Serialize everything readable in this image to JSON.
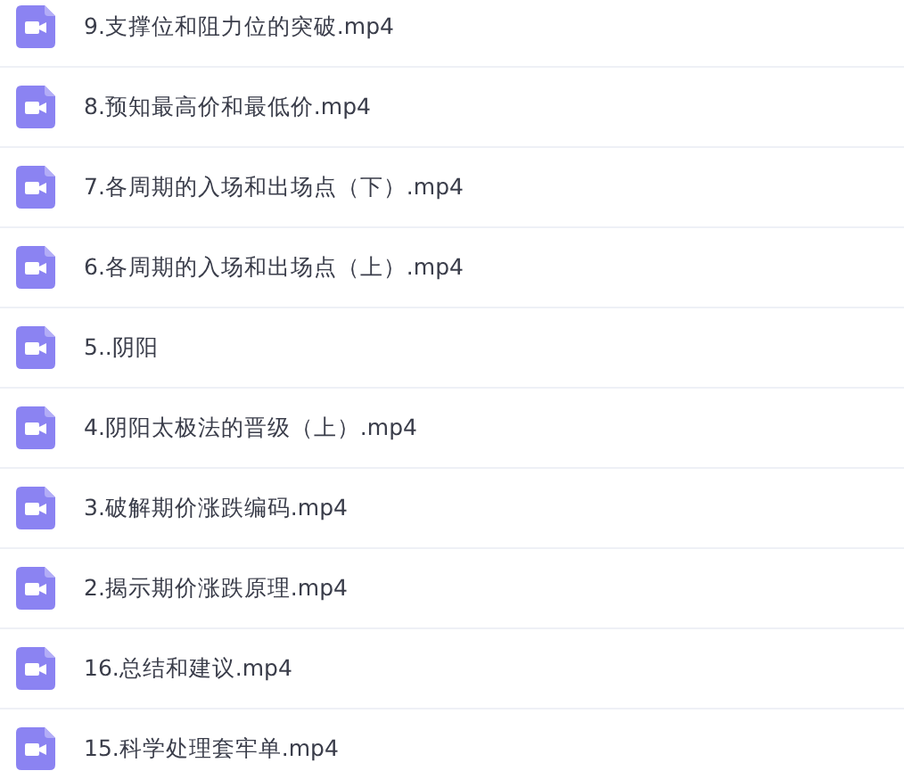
{
  "files": [
    {
      "name": "9.支撑位和阻力位的突破.mp4"
    },
    {
      "name": "8.预知最高价和最低价.mp4"
    },
    {
      "name": "7.各周期的入场和出场点（下）.mp4"
    },
    {
      "name": "6.各周期的入场和出场点（上）.mp4"
    },
    {
      "name": "5..阴阳"
    },
    {
      "name": "4.阴阳太极法的晋级（上）.mp4"
    },
    {
      "name": "3.破解期价涨跌编码.mp4"
    },
    {
      "name": "2.揭示期价涨跌原理.mp4"
    },
    {
      "name": "16.总结和建议.mp4"
    },
    {
      "name": "15.科学处理套牢单.mp4"
    }
  ]
}
